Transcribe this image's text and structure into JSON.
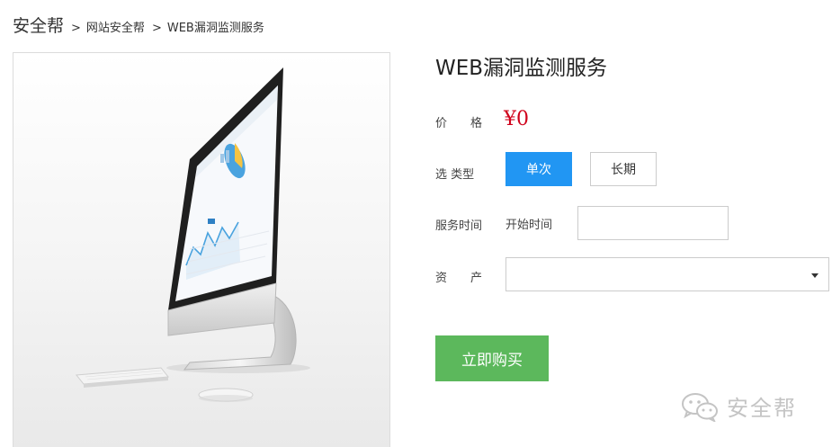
{
  "breadcrumb": {
    "home": "安全帮",
    "separator": ">",
    "items": [
      "网站安全帮",
      "WEB漏洞监测服务"
    ]
  },
  "product": {
    "title": "WEB漏洞监测服务",
    "price_label": "价　　格",
    "price": "¥0",
    "type_label": "选 类型",
    "type_options": [
      "单次",
      "长期"
    ],
    "type_selected": "单次",
    "service_time_label": "服务时间",
    "start_time_label": "开始时间",
    "start_time_value": "",
    "asset_label": "资　　产",
    "asset_value": "",
    "buy_label": "立即购买"
  },
  "watermark": {
    "text": "安全帮",
    "icon": "wechat-icon"
  },
  "colors": {
    "accent_blue": "#2196f3",
    "buy_green": "#5cb85c",
    "price_red": "#d0021b"
  }
}
